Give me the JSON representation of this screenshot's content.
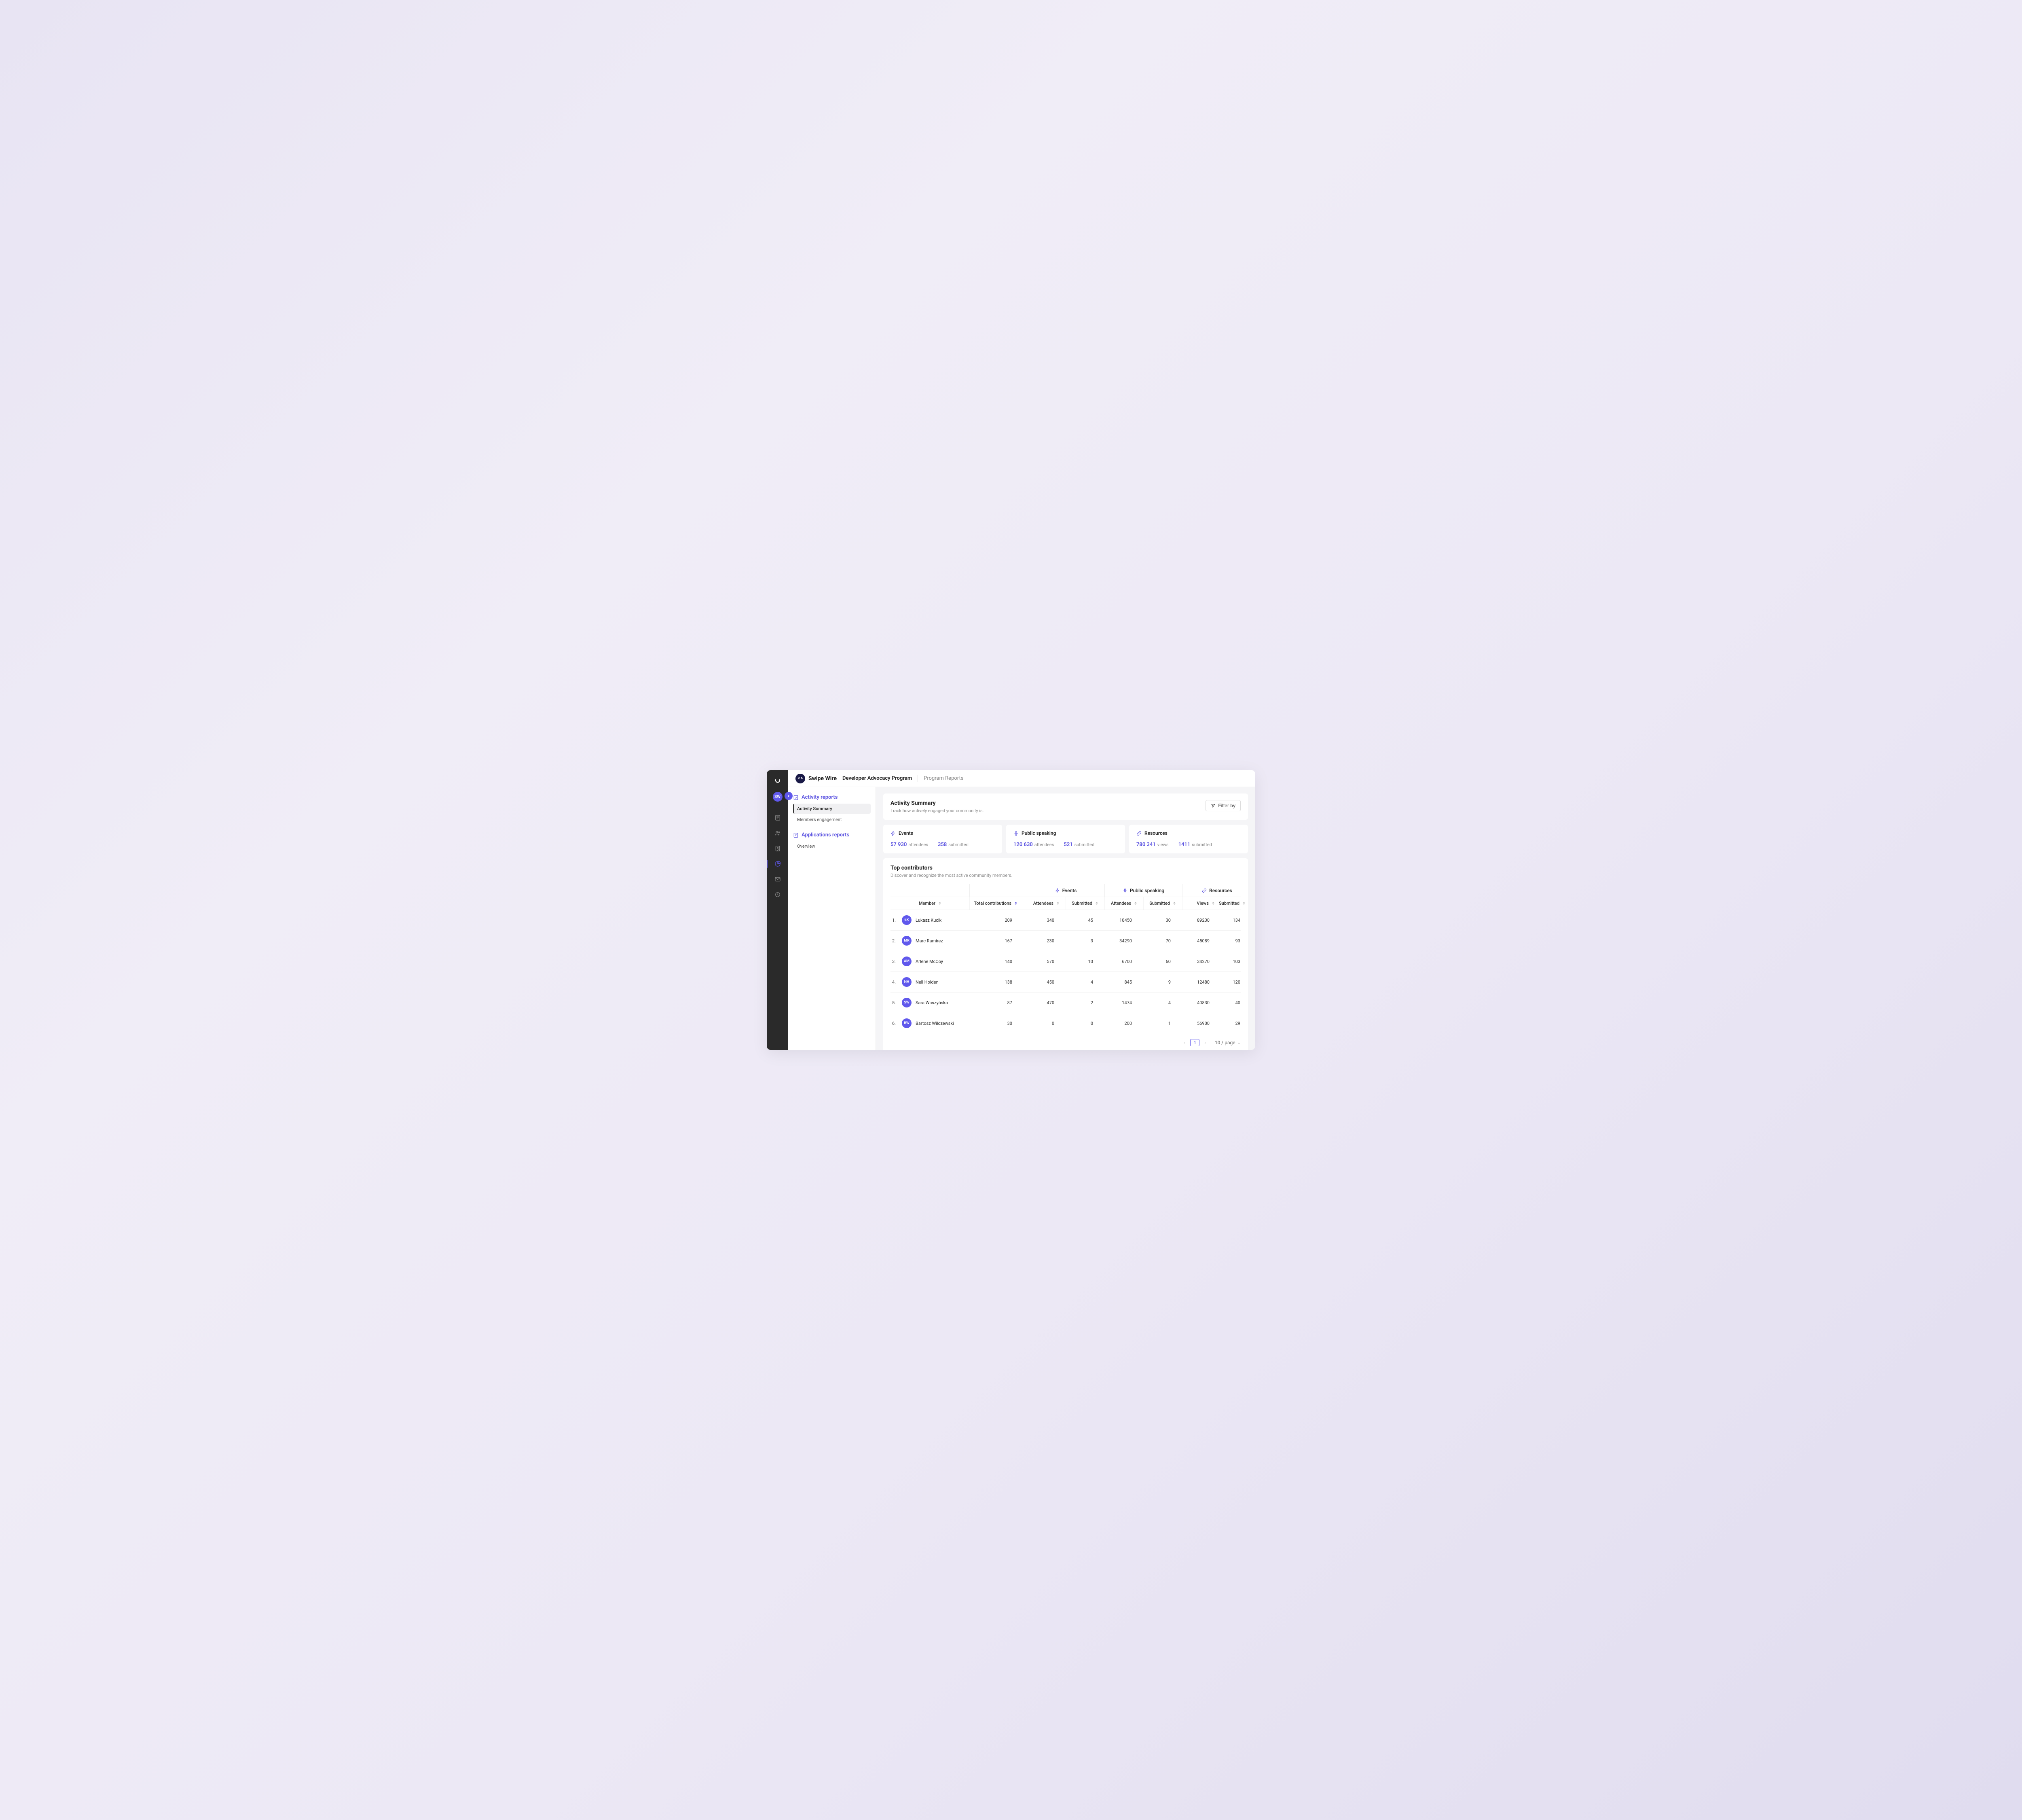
{
  "brand": {
    "name": "Swipe Wire",
    "badge": "< >",
    "avatar": "SW"
  },
  "header": {
    "program": "Developer Advocacy Program",
    "page": "Program Reports"
  },
  "sidebar": {
    "group1": {
      "title": "Activity reports",
      "items": [
        "Activity Summary",
        "Members engagement"
      ],
      "activeIndex": 0
    },
    "group2": {
      "title": "Applications reports",
      "items": [
        "Overview"
      ]
    }
  },
  "summary": {
    "title": "Activity Summary",
    "subtitle": "Track how actively engaged your community is.",
    "filter_label": "Filter by"
  },
  "stats": {
    "events": {
      "title": "Events",
      "m1_value": "57 930",
      "m1_label": "attendees",
      "m2_value": "358",
      "m2_label": "submitted"
    },
    "speaking": {
      "title": "Public speaking",
      "m1_value": "120 630",
      "m1_label": "attendees",
      "m2_value": "521",
      "m2_label": "submitted"
    },
    "resources": {
      "title": "Resources",
      "m1_value": "780 341",
      "m1_label": "views",
      "m2_value": "1411",
      "m2_label": "submitted"
    }
  },
  "contributors": {
    "title": "Top contributors",
    "subtitle": "Discover and recognize the most active community members.",
    "groups": {
      "events": "Events",
      "speaking": "Public speaking",
      "resources": "Resources"
    },
    "columns": {
      "member": "Member",
      "total": "Total contributions",
      "attendees": "Attendees",
      "submitted": "Submitted",
      "views": "Views"
    },
    "rows": [
      {
        "rank": "1.",
        "initials": "ŁK",
        "name": "Łukasz Kucik",
        "total": "209",
        "ev_att": "340",
        "ev_sub": "45",
        "ps_att": "10450",
        "ps_sub": "30",
        "rs_views": "89230",
        "rs_sub": "134"
      },
      {
        "rank": "2.",
        "initials": "MR",
        "name": "Marc Ramirez",
        "total": "167",
        "ev_att": "230",
        "ev_sub": "3",
        "ps_att": "34290",
        "ps_sub": "70",
        "rs_views": "45089",
        "rs_sub": "93"
      },
      {
        "rank": "3.",
        "initials": "AM",
        "name": "Arlene McCoy",
        "total": "140",
        "ev_att": "570",
        "ev_sub": "10",
        "ps_att": "6700",
        "ps_sub": "60",
        "rs_views": "34270",
        "rs_sub": "103"
      },
      {
        "rank": "4.",
        "initials": "NH",
        "name": "Neil Holden",
        "total": "138",
        "ev_att": "450",
        "ev_sub": "4",
        "ps_att": "845",
        "ps_sub": "9",
        "rs_views": "12480",
        "rs_sub": "120"
      },
      {
        "rank": "5.",
        "initials": "SW",
        "name": "Sara Waszyńska",
        "total": "87",
        "ev_att": "470",
        "ev_sub": "2",
        "ps_att": "1474",
        "ps_sub": "4",
        "rs_views": "40830",
        "rs_sub": "40"
      },
      {
        "rank": "6.",
        "initials": "BW",
        "name": "Bartosz Wilczewski",
        "total": "30",
        "ev_att": "0",
        "ev_sub": "0",
        "ps_att": "200",
        "ps_sub": "1",
        "rs_views": "56900",
        "rs_sub": "29"
      }
    ]
  },
  "pagination": {
    "page": "1",
    "per_page": "10 / page"
  }
}
